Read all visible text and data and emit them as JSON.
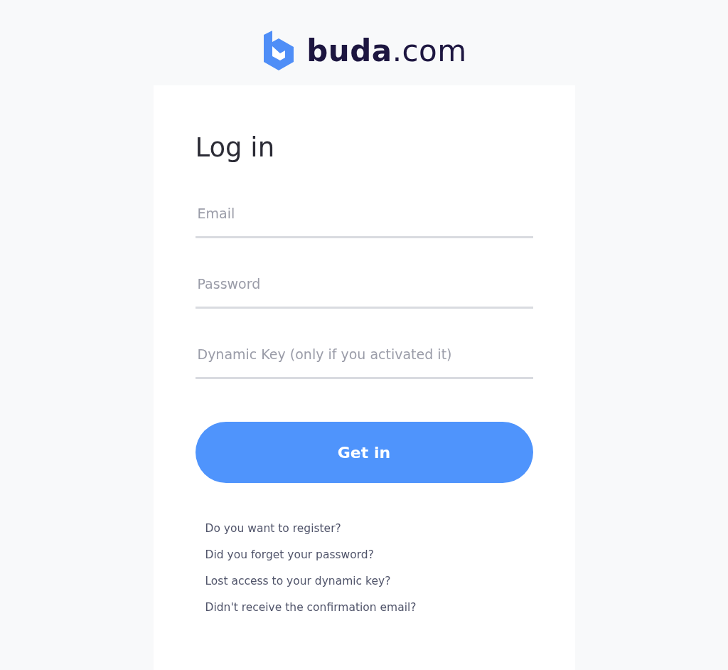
{
  "logo": {
    "text": "**buda**.com"
  },
  "form": {
    "title": "Log in",
    "fields": [
      {
        "placeholder": "Email"
      },
      {
        "placeholder": "Password"
      },
      {
        "placeholder": "Dynamic Key (only if you activated it)"
      }
    ],
    "submit": "Get in",
    "links": [
      "Do you want to register?",
      "Did you forget your password?",
      "Lost access to your dynamic key?",
      "Didn't receive the confirmation email?"
    ]
  }
}
